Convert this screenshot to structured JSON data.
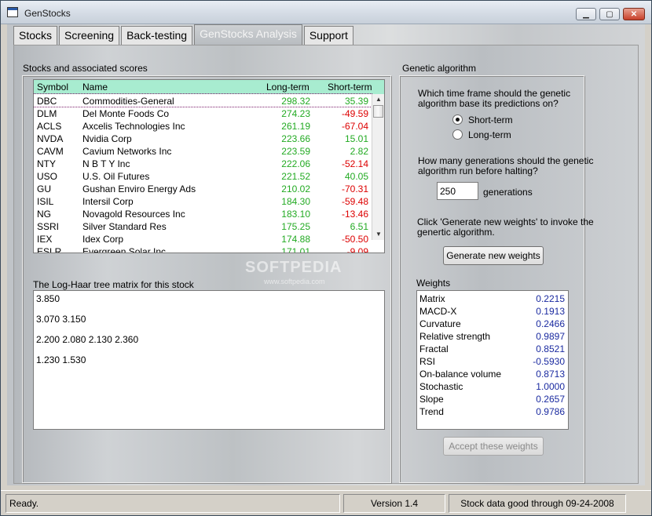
{
  "window": {
    "title": "GenStocks",
    "minimize_icon": "minimize-icon",
    "maximize_icon": "maximize-icon",
    "close_icon": "close-icon"
  },
  "tabs": [
    {
      "label": "Stocks",
      "active": false
    },
    {
      "label": "Screening",
      "active": false
    },
    {
      "label": "Back-testing",
      "active": false
    },
    {
      "label": "GenStocks Analysis",
      "active": true
    },
    {
      "label": "Support",
      "active": false
    }
  ],
  "stocks": {
    "group_title": "Stocks and associated scores",
    "headers": {
      "symbol": "Symbol",
      "name": "Name",
      "long": "Long-term",
      "short": "Short-term"
    },
    "rows": [
      {
        "symbol": "DBC",
        "name": "Commodities-General",
        "long": "298.32",
        "short": "35.39"
      },
      {
        "symbol": "DLM",
        "name": "Del Monte Foods Co",
        "long": "274.23",
        "short": "-49.59"
      },
      {
        "symbol": "ACLS",
        "name": "Axcelis Technologies Inc",
        "long": "261.19",
        "short": "-67.04"
      },
      {
        "symbol": "NVDA",
        "name": "Nvidia Corp",
        "long": "223.66",
        "short": "15.01"
      },
      {
        "symbol": "CAVM",
        "name": "Cavium Networks Inc",
        "long": "223.59",
        "short": "2.82"
      },
      {
        "symbol": "NTY",
        "name": "N B T Y Inc",
        "long": "222.06",
        "short": "-52.14"
      },
      {
        "symbol": "USO",
        "name": "U.S. Oil Futures",
        "long": "221.52",
        "short": "40.05"
      },
      {
        "symbol": "GU",
        "name": "Gushan Enviro Energy Ads",
        "long": "210.02",
        "short": "-70.31"
      },
      {
        "symbol": "ISIL",
        "name": "Intersil Corp",
        "long": "184.30",
        "short": "-59.48"
      },
      {
        "symbol": "NG",
        "name": "Novagold Resources Inc",
        "long": "183.10",
        "short": "-13.46"
      },
      {
        "symbol": "SSRI",
        "name": "Silver Standard Res",
        "long": "175.25",
        "short": "6.51"
      },
      {
        "symbol": "IEX",
        "name": "Idex Corp",
        "long": "174.88",
        "short": "-50.50"
      },
      {
        "symbol": "ESLR",
        "name": "Evergreen Solar Inc",
        "long": "171.01",
        "short": "-9.09"
      }
    ]
  },
  "matrix": {
    "title": "The Log-Haar tree matrix for this stock",
    "lines": [
      "3.850",
      "3.070  3.150",
      "2.200  2.080  2.130  2.360",
      "1.230  1.530"
    ]
  },
  "genetic": {
    "group_title": "Genetic algorithm",
    "timeframe_question_1": "Which time frame should the genetic",
    "timeframe_question_2": "algorithm base its predictions on?",
    "option_short": "Short-term",
    "option_long": "Long-term",
    "selected": "Short-term",
    "generations_question_1": "How many generations should the genetic",
    "generations_question_2": "algorithm run before halting?",
    "generations_value": "250",
    "generations_unit": "generations",
    "instruction_1": "Click 'Generate new weights' to invoke the",
    "instruction_2": "genertic algorithm.",
    "generate_label": "Generate new weights",
    "weights_title": "Weights",
    "weights": [
      {
        "name": "Matrix",
        "value": "0.2215"
      },
      {
        "name": "MACD-X",
        "value": "0.1913"
      },
      {
        "name": "Curvature",
        "value": "0.2466"
      },
      {
        "name": "Relative strength",
        "value": "0.9897"
      },
      {
        "name": "Fractal",
        "value": "0.8521"
      },
      {
        "name": "RSI",
        "value": "-0.5930"
      },
      {
        "name": "On-balance volume",
        "value": "0.8713"
      },
      {
        "name": "Stochastic",
        "value": "1.0000"
      },
      {
        "name": "Slope",
        "value": "0.2657"
      },
      {
        "name": "Trend",
        "value": "0.9786"
      }
    ],
    "accept_label": "Accept these weights"
  },
  "watermark": {
    "big": "SOFTPEDIA",
    "small": "www.softpedia.com"
  },
  "status": {
    "ready": "Ready.",
    "version": "Version 1.4",
    "data": "Stock data good through 09-24-2008"
  },
  "colors": {
    "header_bg": "#a8ecd0",
    "positive": "#22aa22",
    "negative": "#dd0000",
    "weight_value": "#1a2aa0"
  }
}
